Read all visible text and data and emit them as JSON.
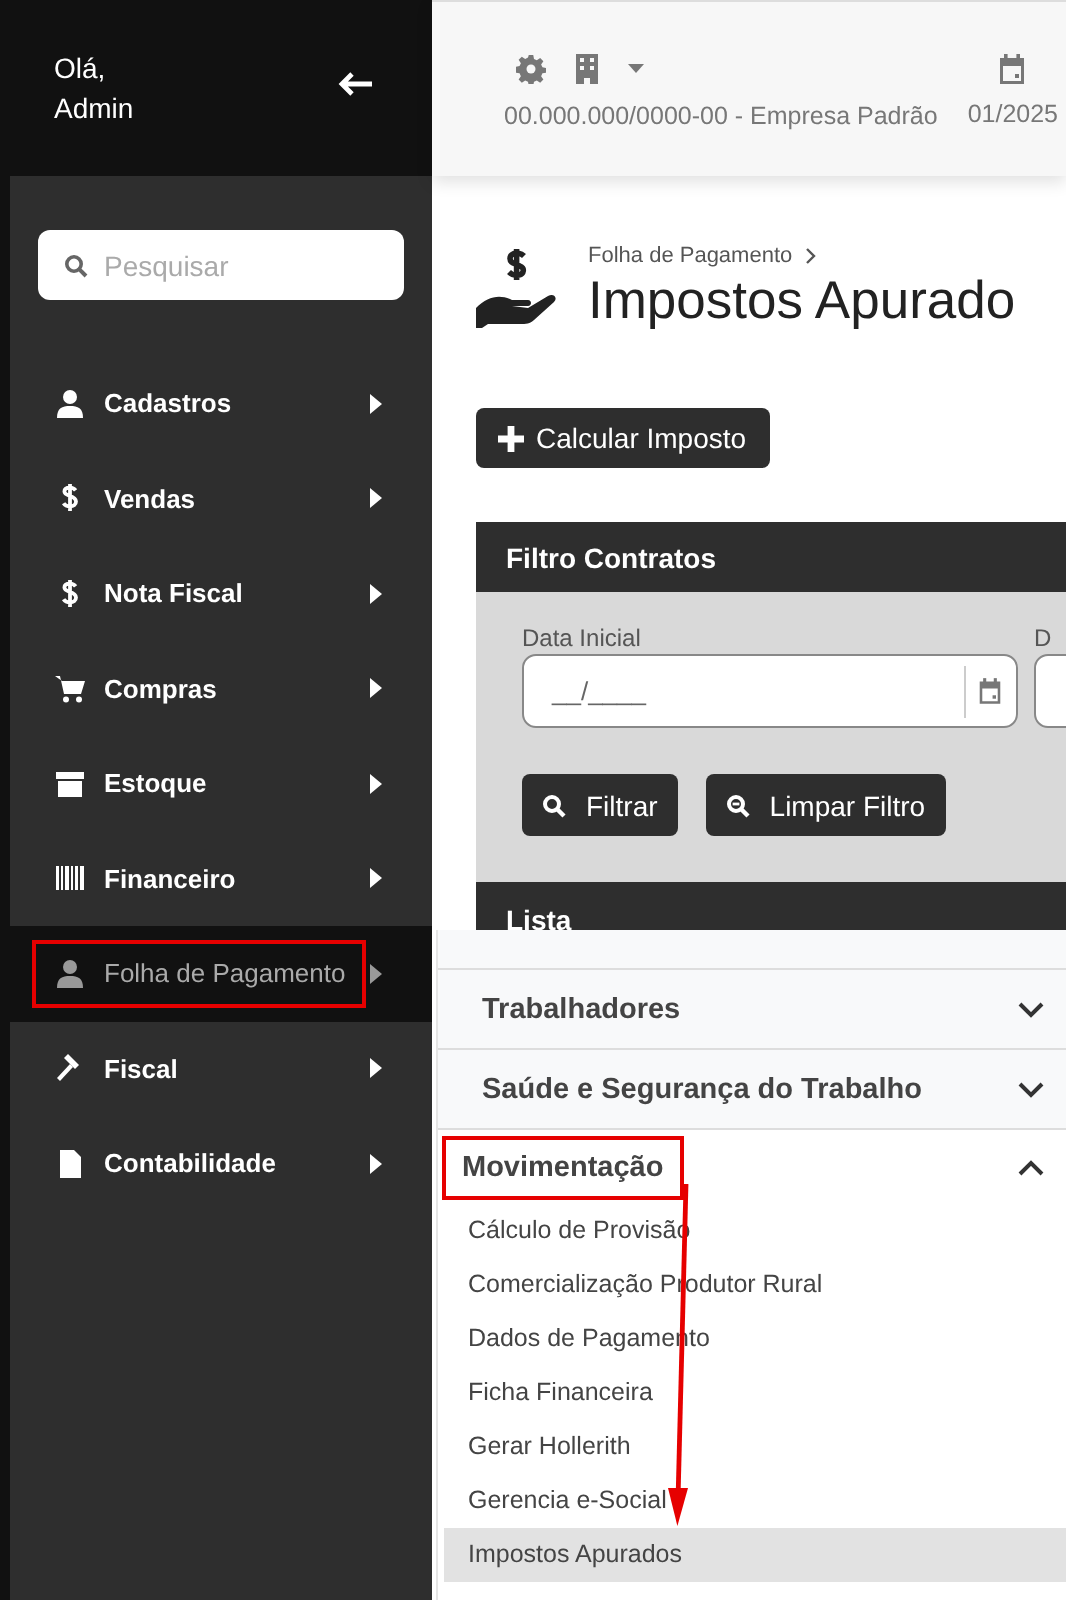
{
  "sidebar": {
    "greeting": "Olá,",
    "user": "Admin",
    "search": {
      "placeholder": "Pesquisar"
    },
    "items": [
      {
        "label": "Cadastros",
        "selected": false,
        "highlighted": false
      },
      {
        "label": "Vendas",
        "selected": false,
        "highlighted": false
      },
      {
        "label": "Nota Fiscal",
        "selected": false,
        "highlighted": false
      },
      {
        "label": "Compras",
        "selected": false,
        "highlighted": false
      },
      {
        "label": "Estoque",
        "selected": false,
        "highlighted": false
      },
      {
        "label": "Financeiro",
        "selected": false,
        "highlighted": false
      },
      {
        "label": "Folha de Pagamento",
        "selected": true,
        "highlighted": true
      },
      {
        "label": "Fiscal",
        "selected": false,
        "highlighted": false
      },
      {
        "label": "Contabilidade",
        "selected": false,
        "highlighted": false
      }
    ]
  },
  "topbar": {
    "company": "00.000.000/0000-00 - Empresa Padrão",
    "period": "01/2025"
  },
  "page": {
    "breadcrumb": "Folha de Pagamento",
    "title": "Impostos Apurado",
    "action": "Calcular Imposto",
    "filter": {
      "title": "Filtro Contratos",
      "fields": [
        {
          "label": "Data Inicial",
          "value": "__/____"
        },
        {
          "label": "D"
        }
      ],
      "buttons": [
        "Filtrar",
        "Limpar Filtro"
      ]
    },
    "list_title": "Lista"
  },
  "submenu": {
    "sections": [
      {
        "title": "Trabalhadores",
        "expanded": false,
        "highlighted": false
      },
      {
        "title": "Saúde e Segurança do Trabalho",
        "expanded": false,
        "highlighted": false
      },
      {
        "title": "Movimentação",
        "expanded": true,
        "highlighted": true,
        "items": [
          {
            "label": "Cálculo de Provisão",
            "selected": false
          },
          {
            "label": "Comercialização Produtor Rural",
            "selected": false
          },
          {
            "label": "Dados de Pagamento",
            "selected": false
          },
          {
            "label": "Ficha Financeira",
            "selected": false
          },
          {
            "label": "Gerar Hollerith",
            "selected": false
          },
          {
            "label": "Gerencia e-Social",
            "selected": false
          },
          {
            "label": "Impostos Apurados",
            "selected": true
          }
        ]
      }
    ]
  }
}
